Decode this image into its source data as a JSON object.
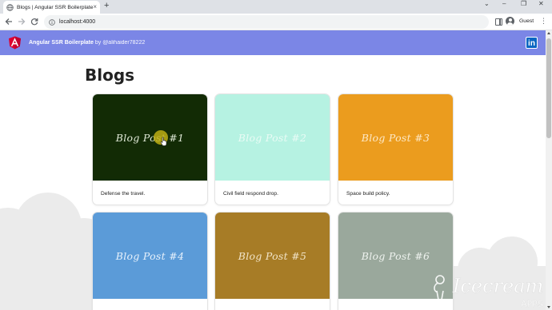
{
  "browser": {
    "tab_title": "Blogs | Angular SSR Boilerplate",
    "tab_close": "×",
    "new_tab": "+",
    "url": "localhost:4000",
    "profile_label": "Guest",
    "menu": "⋮",
    "window_controls": {
      "dropdown": "⌄",
      "minimize": "–",
      "maximize": "❐",
      "close": "✕"
    },
    "icons": [
      "back-arrow-icon",
      "forward-arrow-icon",
      "reload-icon",
      "info-icon",
      "side-panel-icon",
      "profile-icon"
    ]
  },
  "header": {
    "title": "Angular SSR Boilerplate",
    "author": "by @alihaider78222",
    "logo": "angular-logo-icon",
    "linkedin_label": "in",
    "brand_color": "#7b86e6"
  },
  "page": {
    "title": "Blogs"
  },
  "posts": [
    {
      "image_text": "Blog Post #1",
      "text": "Defense the travel.",
      "bg": "#122b05",
      "fg": "#dfe8d6"
    },
    {
      "image_text": "Blog Post #2",
      "text": "Civil field respond drop.",
      "bg": "#b6f2e2",
      "fg": "#e9fbf5"
    },
    {
      "image_text": "Blog Post #3",
      "text": "Space build policy.",
      "bg": "#eb9c1e",
      "fg": "#fde8c6"
    },
    {
      "image_text": "Blog Post #4",
      "text": "",
      "bg": "#5b9bd8",
      "fg": "#e7f1fb"
    },
    {
      "image_text": "Blog Post #5",
      "text": "",
      "bg": "#a77c26",
      "fg": "#f1e4c8"
    },
    {
      "image_text": "Blog Post #6",
      "text": "",
      "bg": "#9aa89c",
      "fg": "#eef2ee"
    }
  ],
  "watermark": {
    "line1": "Icecream",
    "line2": "APPS"
  }
}
